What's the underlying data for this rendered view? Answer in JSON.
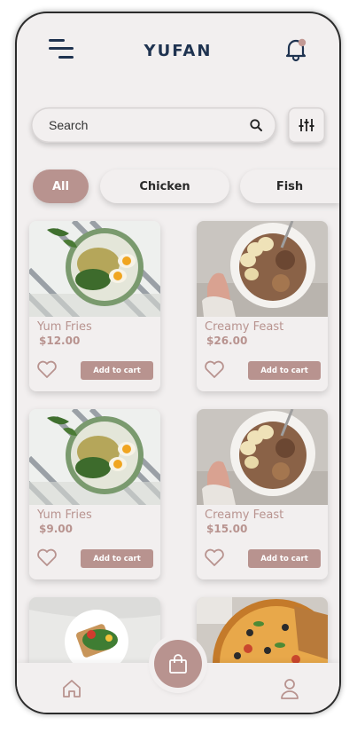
{
  "app": {
    "title": "YUFAN"
  },
  "header": {
    "menu_icon": "hamburger-icon",
    "notification_icon": "bell-icon",
    "accent": "#b8938f",
    "title_color": "#1f3350"
  },
  "search": {
    "placeholder": "Search",
    "icon": "search-icon"
  },
  "filter": {
    "icon": "sliders-icon"
  },
  "categories": [
    {
      "label": "All",
      "active": true
    },
    {
      "label": "Chicken",
      "active": false
    },
    {
      "label": "Fish",
      "active": false
    }
  ],
  "products": [
    {
      "name": "Yum Fries",
      "price": "$12.00",
      "cart_label": "Add to cart"
    },
    {
      "name": "Creamy Feast",
      "price": "$26.00",
      "cart_label": "Add to cart"
    },
    {
      "name": "Yum Fries",
      "price": "$9.00",
      "cart_label": "Add to cart"
    },
    {
      "name": "Creamy Feast",
      "price": "$15.00",
      "cart_label": "Add to cart"
    }
  ],
  "bottom_nav": {
    "home_icon": "home-icon",
    "cart_icon": "shopping-bag-icon",
    "profile_icon": "user-icon"
  }
}
